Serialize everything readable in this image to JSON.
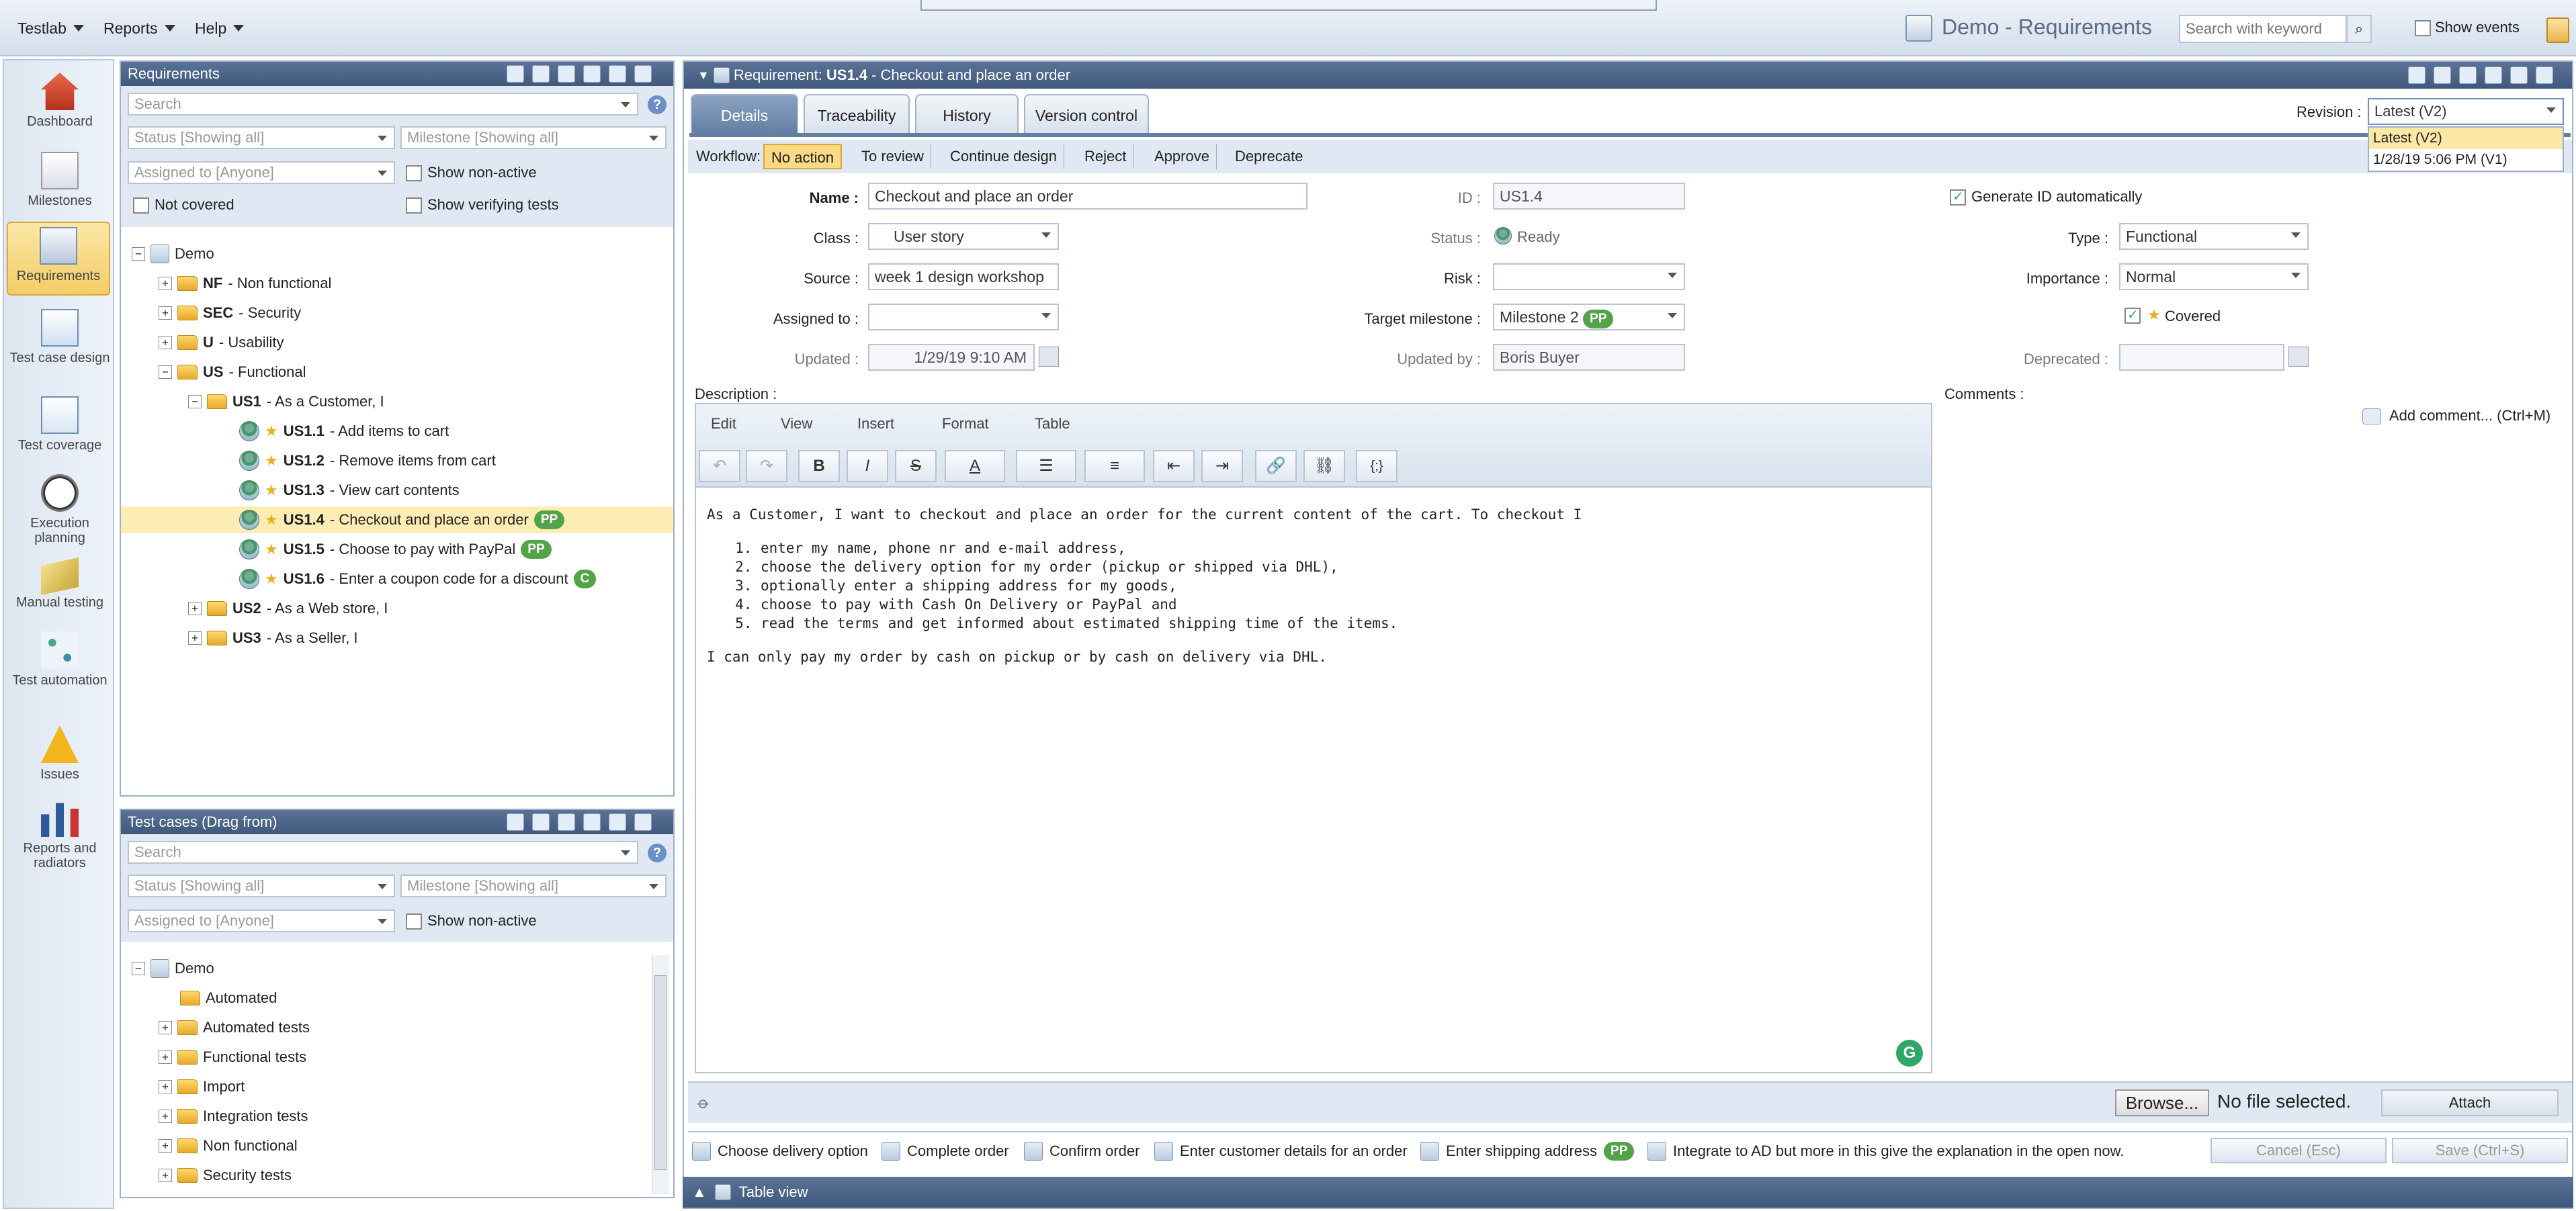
{
  "app": {
    "menus": [
      "Testlab",
      "Reports",
      "Help"
    ],
    "title": "Demo - Requirements",
    "search_placeholder": "Search with keyword",
    "show_events": "Show events"
  },
  "nav": {
    "items": [
      {
        "label": "Dashboard",
        "icon": "home-icon"
      },
      {
        "label": "Milestones",
        "icon": "milestones-icon"
      },
      {
        "label": "Requirements",
        "icon": "requirements-icon"
      },
      {
        "label": "Test case design",
        "icon": "test-case-design-icon"
      },
      {
        "label": "Test coverage",
        "icon": "test-coverage-icon"
      },
      {
        "label": "Execution planning",
        "icon": "clock-icon"
      },
      {
        "label": "Manual testing",
        "icon": "manual-testing-icon"
      },
      {
        "label": "Test automation",
        "icon": "automation-icon"
      },
      {
        "label": "Issues",
        "icon": "warning-icon"
      },
      {
        "label": "Reports and radiators",
        "icon": "bar-chart-icon"
      }
    ]
  },
  "req_panel": {
    "title": "Requirements",
    "search": "Search",
    "status": "Status [Showing all]",
    "milestone": "Milestone [Showing all]",
    "assigned": "Assigned to [Anyone]",
    "show_nonactive": "Show non-active",
    "not_covered": "Not covered",
    "show_verifying": "Show verifying tests",
    "tree": [
      {
        "id": "",
        "text": "Demo"
      },
      {
        "id": "NF",
        "text": " - Non functional"
      },
      {
        "id": "SEC",
        "text": " - Security"
      },
      {
        "id": "U",
        "text": " - Usability"
      },
      {
        "id": "US",
        "text": " - Functional"
      },
      {
        "id": "US1",
        "text": " - As a Customer, I"
      },
      {
        "id": "US1.1",
        "text": " - Add items to cart"
      },
      {
        "id": "US1.2",
        "text": " - Remove items from cart"
      },
      {
        "id": "US1.3",
        "text": " - View cart contents"
      },
      {
        "id": "US1.4",
        "text": " - Checkout and place an order",
        "badge": "PP"
      },
      {
        "id": "US1.5",
        "text": " - Choose to pay with PayPal",
        "badge": "PP"
      },
      {
        "id": "US1.6",
        "text": " - Enter a coupon code for a discount",
        "badge": "C"
      },
      {
        "id": "US2",
        "text": " - As a Web store, I"
      },
      {
        "id": "US3",
        "text": " - As a Seller, I"
      }
    ]
  },
  "tc_panel": {
    "title": "Test cases (Drag from)",
    "search": "Search",
    "status": "Status [Showing all]",
    "milestone": "Milestone [Showing all]",
    "assigned": "Assigned to [Anyone]",
    "show_nonactive": "Show non-active",
    "tree": [
      "Demo",
      "Automated",
      "Automated tests",
      "Functional tests",
      "Import",
      "Integration tests",
      "Non functional",
      "Security tests"
    ]
  },
  "detail": {
    "header_prefix": "Requirement: ",
    "header_id": "US1.4",
    "header_title": " - Checkout and place an order",
    "tabs": [
      "Details",
      "Traceability",
      "History",
      "Version control"
    ],
    "revision_label": "Revision :",
    "revision_value": "Latest (V2)",
    "revision_options": [
      "Latest (V2)",
      "1/28/19 5:06 PM (V1)"
    ],
    "workflow_label": "Workflow:",
    "workflow": [
      "No action",
      "To review",
      "Continue design",
      "Reject",
      "Approve",
      "Deprecate"
    ],
    "fields": {
      "name_l": "Name :",
      "name_v": "Checkout and place an order",
      "class_l": "Class :",
      "class_v": "User story",
      "source_l": "Source :",
      "source_v": "week 1 design workshop",
      "assigned_l": "Assigned to :",
      "assigned_v": "",
      "updated_l": "Updated :",
      "updated_v": "1/29/19 9:10 AM",
      "id_l": "ID :",
      "id_v": "US1.4",
      "status_l": "Status :",
      "status_v": "Ready",
      "risk_l": "Risk :",
      "risk_v": "",
      "milestone_l": "Target milestone :",
      "milestone_v": "Milestone 2",
      "milestone_badge": "PP",
      "updatedby_l": "Updated by :",
      "updatedby_v": "Boris Buyer",
      "genid": "Generate ID automatically",
      "type_l": "Type :",
      "type_v": "Functional",
      "importance_l": "Importance :",
      "importance_v": "Normal",
      "covered": "Covered",
      "deprecated_l": "Deprecated :",
      "deprecated_v": ""
    },
    "description_label": "Description :",
    "comments_label": "Comments :",
    "add_comment": "Add comment... (Ctrl+M)",
    "editor_menus": [
      "Edit",
      "View",
      "Insert",
      "Format",
      "Table"
    ],
    "desc_intro": "As a Customer, I want to checkout and place an order for the current content of the cart. To checkout I",
    "desc_items": [
      "enter my name, phone nr and e-mail address,",
      "choose the delivery option for my order (pickup or shipped via DHL),",
      "optionally enter a shipping address for my goods,",
      "choose to pay with Cash On Delivery or PayPal and",
      "read the terms and get informed about estimated shipping time of the items."
    ],
    "desc_outro": "I can only pay my order by cash on pickup or by cash on delivery via DHL.",
    "browse": "Browse...",
    "no_file": "No file selected.",
    "attach": "Attach",
    "related": [
      {
        "text": "Choose delivery option"
      },
      {
        "text": "Complete order"
      },
      {
        "text": "Confirm order"
      },
      {
        "text": "Enter customer details for an order"
      },
      {
        "text": "Enter shipping address",
        "badge": "PP"
      },
      {
        "text": "Integrate to AD but more in this give the explanation in the open now."
      }
    ],
    "cancel": "Cancel (Esc)",
    "save": "Save (Ctrl+S)",
    "table_view": "Table view"
  }
}
